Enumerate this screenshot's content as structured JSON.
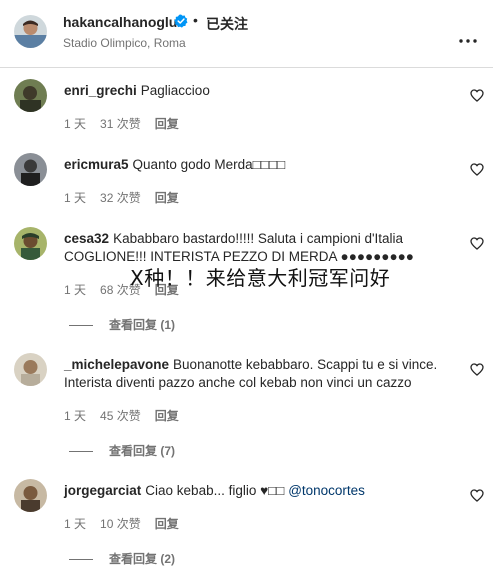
{
  "header": {
    "username": "hakancalhanoglu",
    "dot": "•",
    "follow_label": "已关注",
    "location": "Stadio Olimpico, Roma",
    "verified_color": "#0095f6"
  },
  "comments": [
    {
      "username": "enri_grechi",
      "text": "Pagliaccioo",
      "time": "1 天",
      "likes": "31 次赞",
      "reply": "回复"
    },
    {
      "username": "ericmura5",
      "text": "Quanto godo Merda□□□□",
      "time": "1 天",
      "likes": "32 次赞",
      "reply": "回复"
    },
    {
      "username": "cesa32",
      "text": "Kababbaro bastardo!!!!! Saluta i campioni d'Italia COGLIONE!!! INTERISTA PEZZO DI MERDA ●●●●●●●●●",
      "time": "1 天",
      "likes": "68 次赞",
      "reply": "回复",
      "view_replies": "查看回复 (1)"
    },
    {
      "username": "_michelepavone",
      "text": "Buonanotte kebabbaro. Scappi tu e si vince. Interista diventi pazzo anche col kebab non vinci un cazzo",
      "time": "1 天",
      "likes": "45 次赞",
      "reply": "回复",
      "view_replies": "查看回复 (7)"
    },
    {
      "username": "jorgegarciat",
      "text": "Ciao kebab... figlio ♥□□",
      "mention": "@tonocortes",
      "time": "1 天",
      "likes": "10 次赞",
      "reply": "回复",
      "view_replies": "查看回复 (2)"
    }
  ],
  "overlay_caption": "X种！！来给意大利冠军问好",
  "colors": {
    "text": "#262626",
    "secondary": "#737373",
    "link": "#00376b",
    "divider": "#dbdbdb"
  }
}
